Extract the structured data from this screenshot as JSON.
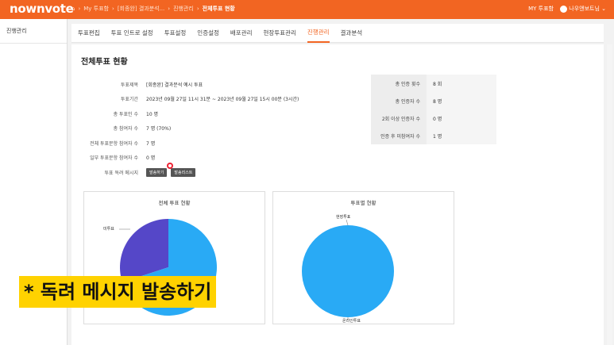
{
  "header": {
    "logo": "nownvote",
    "breadcrumbs": [
      "My 투표함",
      "[회종완] 결과분석...",
      "진행관리"
    ],
    "current": "전체투표 현황",
    "my_box": "MY 투표함",
    "user": "나우앤보트님"
  },
  "sidebar": {
    "items": [
      {
        "label": "진행관리"
      }
    ]
  },
  "tabs": [
    {
      "label": "투표편집"
    },
    {
      "label": "투표 인트로 설정"
    },
    {
      "label": "투표설정"
    },
    {
      "label": "인증설정"
    },
    {
      "label": "배포관리"
    },
    {
      "label": "현장투표관리"
    },
    {
      "label": "진행관리",
      "active": true
    },
    {
      "label": "결과분석"
    }
  ],
  "page": {
    "title": "전체투표 현황"
  },
  "info": {
    "title_label": "투표제목",
    "title_value": "[회종완] 결과분석 예시 투표",
    "period_label": "투표기간",
    "period_value": "2023년 09월 27일 11시 31분 ~ 2023년 09월 27일 15시 00분 (3시간)",
    "voters_label": "총 투표인 수",
    "voters_value": "10 명",
    "participants_label": "총 참여자 수",
    "participants_value": "7 명 (70%)",
    "full_label": "전체 투표문항 참여자 수",
    "full_value": "7 명",
    "partial_label": "일부 투표문항 참여자 수",
    "partial_value": "0 명",
    "reminder_label": "투표 독려 메시지",
    "send_btn": "발송하기",
    "list_btn": "발송리스트"
  },
  "stats": [
    {
      "k": "총 인증 횟수",
      "v": "8 회"
    },
    {
      "k": "총 인증자 수",
      "v": "8 명"
    },
    {
      "k": "2회 이상 인증자 수",
      "v": "0 명"
    },
    {
      "k": "인증 후 미참여자 수",
      "v": "1 명"
    }
  ],
  "charts": {
    "left_title": "전체 투표 현황",
    "left_label": "미투표",
    "right_title": "투표별 현황",
    "right_top_label": "현장투표",
    "right_bottom_label": "온라인투표"
  },
  "chart_data": [
    {
      "type": "pie",
      "title": "전체 투표 현황",
      "labels": [
        "미투표",
        ""
      ],
      "values": [
        30,
        70
      ],
      "colors": [
        "#5547c8",
        "#29aaf5"
      ]
    },
    {
      "type": "pie",
      "title": "투표별 현황",
      "labels": [
        "현장투표",
        "온라인투표"
      ],
      "values": [
        0,
        100
      ],
      "colors": [
        "#5547c8",
        "#29aaf5"
      ]
    }
  ],
  "caption": "* 독려 메시지 발송하기"
}
